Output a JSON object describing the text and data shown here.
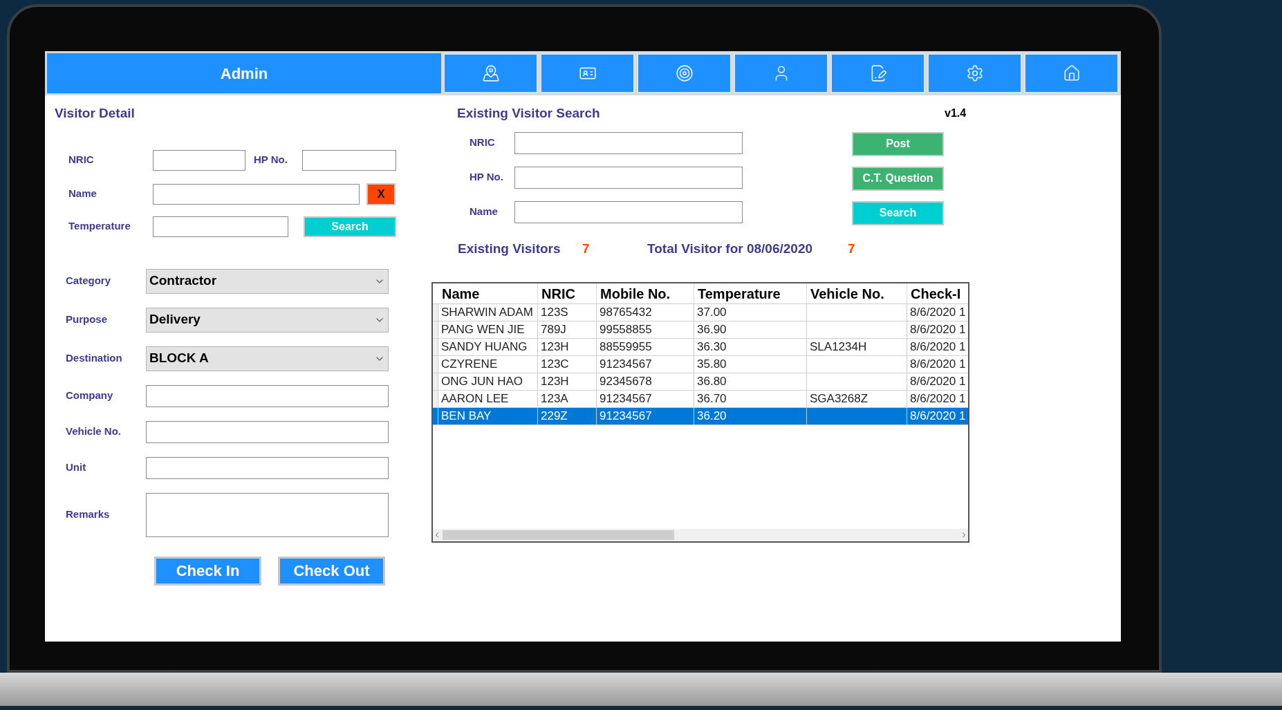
{
  "header": {
    "title": "Admin"
  },
  "visitor_detail": {
    "title": "Visitor Detail",
    "nric_label": "NRIC",
    "hp_label": "HP No.",
    "name_label": "Name",
    "clear_button": "X",
    "temperature_label": "Temperature",
    "search_button": "Search",
    "fields": [
      {
        "label": "Category",
        "kind": "select",
        "value": "Contractor"
      },
      {
        "label": "Purpose",
        "kind": "select",
        "value": "Delivery"
      },
      {
        "label": "Destination",
        "kind": "select",
        "value": "BLOCK A"
      },
      {
        "label": "Company",
        "kind": "input"
      },
      {
        "label": "Vehicle No.",
        "kind": "input"
      },
      {
        "label": "Unit",
        "kind": "input"
      },
      {
        "label": "Remarks",
        "kind": "textarea"
      }
    ],
    "buttons": [
      "Check In",
      "Check Out"
    ]
  },
  "visitor_search": {
    "title": "Existing Visitor Search",
    "version": "v1.4",
    "fields": [
      {
        "label": "NRIC"
      },
      {
        "label": "HP No."
      },
      {
        "label": "Name"
      }
    ],
    "buttons": [
      {
        "label": "Post",
        "kind": "green"
      },
      {
        "label": "C.T. Question",
        "kind": "green"
      },
      {
        "label": "Search",
        "kind": "cyan"
      }
    ],
    "existing_label": "Existing Visitors",
    "existing_count": "7",
    "total_label": "Total Visitor for 08/06/2020",
    "total_count": "7"
  },
  "table": {
    "columns": [
      "Name",
      "NRIC",
      "Mobile No.",
      "Temperature",
      "Vehicle No.",
      "Check-I"
    ],
    "rows": [
      {
        "selected": false,
        "cells": [
          "SHARWIN ADAM",
          "123S",
          "98765432",
          "37.00",
          "",
          "8/6/2020 1"
        ]
      },
      {
        "selected": false,
        "cells": [
          "PANG WEN JIE",
          "789J",
          "99558855",
          "36.90",
          "",
          "8/6/2020 1"
        ]
      },
      {
        "selected": false,
        "cells": [
          "SANDY HUANG",
          "123H",
          "88559955",
          "36.30",
          "SLA1234H",
          "8/6/2020 1"
        ]
      },
      {
        "selected": false,
        "cells": [
          "CZYRENE",
          "123C",
          "91234567",
          "35.80",
          "",
          "8/6/2020 1"
        ]
      },
      {
        "selected": false,
        "cells": [
          "ONG JUN HAO",
          "123H",
          "92345678",
          "36.80",
          "",
          "8/6/2020 1"
        ]
      },
      {
        "selected": false,
        "cells": [
          "AARON LEE",
          "123A",
          "91234567",
          "36.70",
          "SGA3268Z",
          "8/6/2020 1"
        ]
      },
      {
        "selected": true,
        "cells": [
          "BEN BAY",
          "229Z",
          "91234567",
          "36.20",
          "",
          "8/6/2020 1"
        ]
      }
    ]
  }
}
